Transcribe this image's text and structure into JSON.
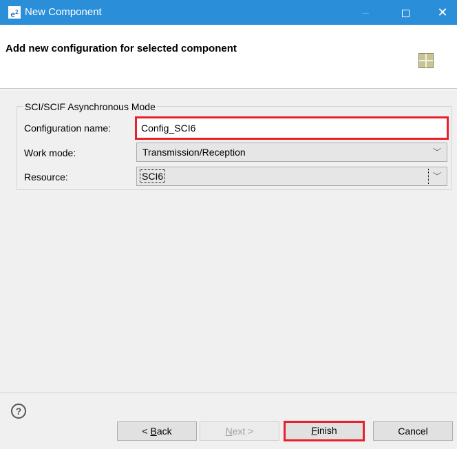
{
  "window": {
    "logo": "e²",
    "title": "New Component"
  },
  "header": {
    "title": "Add new configuration for selected component"
  },
  "group": {
    "legend": "SCI/SCIF Asynchronous Mode",
    "config_name_label": "Configuration name:",
    "config_name_value": "Config_SCI6",
    "work_mode_label": "Work mode:",
    "work_mode_value": "Transmission/Reception",
    "resource_label": "Resource:",
    "resource_value": "SCI6"
  },
  "buttons": {
    "back_mnemonic": "B",
    "back_prefix": "< ",
    "back_rest": "ack",
    "next_mnemonic": "N",
    "next_rest": "ext >",
    "finish_mnemonic": "F",
    "finish_rest": "inish",
    "cancel": "Cancel"
  },
  "icons": {
    "help": "help-icon",
    "component": "component-grid-icon",
    "dropdown": "chevron-down-icon"
  },
  "colors": {
    "titlebar": "#2b8ed8",
    "highlight": "#e8202a"
  }
}
